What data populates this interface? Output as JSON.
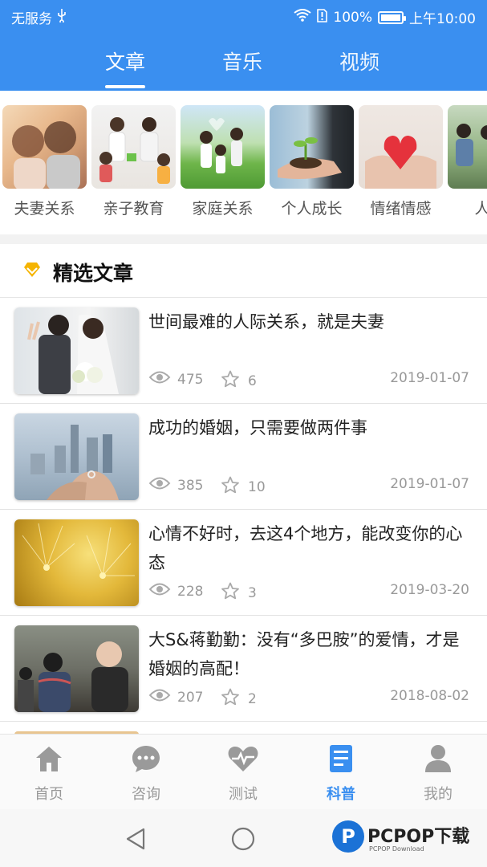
{
  "status_bar": {
    "carrier": "无服务",
    "battery_percent": "100%",
    "time": "上午10:00"
  },
  "top_tabs": [
    {
      "label": "文章",
      "active": true
    },
    {
      "label": "音乐",
      "active": false
    },
    {
      "label": "视频",
      "active": false
    }
  ],
  "categories": [
    {
      "label": "夫妻关系"
    },
    {
      "label": "亲子教育"
    },
    {
      "label": "家庭关系"
    },
    {
      "label": "个人成长"
    },
    {
      "label": "情绪情感"
    },
    {
      "label": "人际"
    }
  ],
  "featured": {
    "title": "精选文章"
  },
  "articles": [
    {
      "title": "世间最难的人际关系，就是夫妻",
      "views": "475",
      "stars": "6",
      "date": "2019-01-07"
    },
    {
      "title": "成功的婚姻，只需要做两件事",
      "views": "385",
      "stars": "10",
      "date": "2019-01-07"
    },
    {
      "title": "心情不好时，去这4个地方，能改变你的心态",
      "views": "228",
      "stars": "3",
      "date": "2019-03-20"
    },
    {
      "title": "大S&蒋勤勤：没有“多巴胺”的爱情，才是婚姻的高配！",
      "views": "207",
      "stars": "2",
      "date": "2018-08-02"
    }
  ],
  "bottom_nav": [
    {
      "label": "首页",
      "icon": "home-icon",
      "active": false
    },
    {
      "label": "咨询",
      "icon": "chat-icon",
      "active": false
    },
    {
      "label": "测试",
      "icon": "heart-pulse-icon",
      "active": false
    },
    {
      "label": "科普",
      "icon": "document-icon",
      "active": true
    },
    {
      "label": "我的",
      "icon": "person-icon",
      "active": false
    }
  ],
  "watermark": {
    "text": "PCPOP下载",
    "sub": "PCPOP Download"
  },
  "colors": {
    "brand": "#3a8ff0",
    "gold": "#f5b400"
  }
}
